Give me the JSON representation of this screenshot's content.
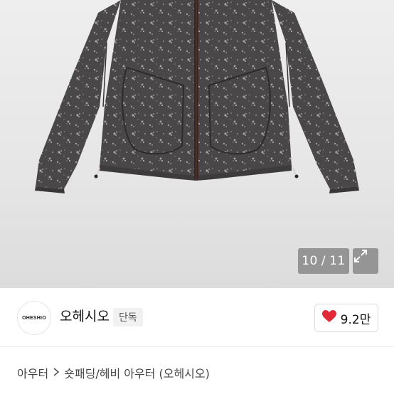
{
  "gallery": {
    "current": "10",
    "separator": "/",
    "total": "11",
    "expand_icon": "expand-icon"
  },
  "store": {
    "logo_text": "OHESHIO",
    "name": "오헤시오",
    "badge": "단독",
    "like_icon": "heart-icon",
    "like_color": "#e02a3a",
    "like_count": "9.2만"
  },
  "breadcrumb": {
    "category": "아우터",
    "separator_icon": "chevron-right-icon",
    "subcategory": "숏패딩/헤비 아우터 (오헤시오)"
  }
}
